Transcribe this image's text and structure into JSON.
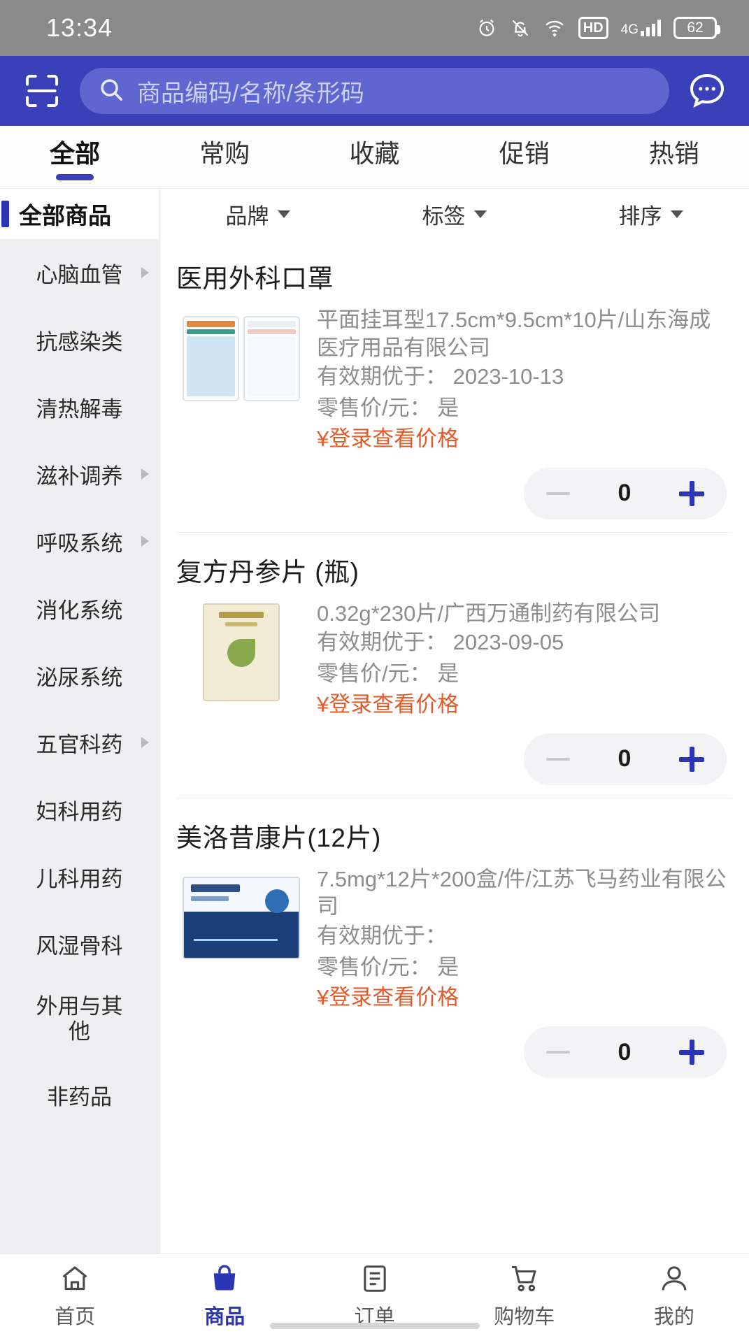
{
  "status_bar": {
    "time": "13:34",
    "icons": [
      "alarm-icon",
      "mute-icon",
      "wifi-icon",
      "hd-icon",
      "signal-4g-icon",
      "battery-icon"
    ],
    "hd_label": "HD",
    "network_label": "4G",
    "battery_level": "62"
  },
  "search": {
    "scan_icon": "scan-icon",
    "search_icon": "search-icon",
    "placeholder": "商品编码/名称/条形码",
    "value": "",
    "more_icon": "chat-more-icon"
  },
  "tabs": [
    {
      "label": "全部",
      "active": true
    },
    {
      "label": "常购",
      "active": false
    },
    {
      "label": "收藏",
      "active": false
    },
    {
      "label": "促销",
      "active": false
    },
    {
      "label": "热销",
      "active": false
    }
  ],
  "sidebar": {
    "title": "全部商品",
    "items": [
      {
        "label": "心脑血管",
        "has_arrow": true
      },
      {
        "label": "抗感染类",
        "has_arrow": false
      },
      {
        "label": "清热解毒",
        "has_arrow": false
      },
      {
        "label": "滋补调养",
        "has_arrow": true
      },
      {
        "label": "呼吸系统",
        "has_arrow": true
      },
      {
        "label": "消化系统",
        "has_arrow": false
      },
      {
        "label": "泌尿系统",
        "has_arrow": false
      },
      {
        "label": "五官科药",
        "has_arrow": true
      },
      {
        "label": "妇科用药",
        "has_arrow": false
      },
      {
        "label": "儿科用药",
        "has_arrow": false
      },
      {
        "label": "风湿骨科",
        "has_arrow": false
      },
      {
        "label": "外用与其他",
        "has_arrow": false
      },
      {
        "label": "非药品",
        "has_arrow": false
      }
    ]
  },
  "filters": [
    {
      "label": "品牌",
      "icon": "chevron-down-icon"
    },
    {
      "label": "标签",
      "icon": "chevron-down-icon"
    },
    {
      "label": "排序",
      "icon": "chevron-down-icon"
    }
  ],
  "products": [
    {
      "name": "医用外科口罩",
      "spec": "平面挂耳型17.5cm*9.5cm*10片/山东海成医疗用品有限公司",
      "expiry_label": "有效期优于：",
      "expiry_value": "2023-10-13",
      "retail_label": "零售价/元：",
      "retail_value": "是",
      "price_text": "¥登录查看价格",
      "quantity": "0",
      "minus_icon": "minus-icon",
      "plus_icon": "plus-icon",
      "thumb": "mask-package-image"
    },
    {
      "name": "复方丹参片 (瓶)",
      "spec": "0.32g*230片/广西万通制药有限公司",
      "expiry_label": "有效期优于：",
      "expiry_value": "2023-09-05",
      "retail_label": "零售价/元：",
      "retail_value": "是",
      "price_text": "¥登录查看价格",
      "quantity": "0",
      "minus_icon": "minus-icon",
      "plus_icon": "plus-icon",
      "thumb": "danshen-box-image"
    },
    {
      "name": "美洛昔康片(12片)",
      "spec": "7.5mg*12片*200盒/件/江苏飞马药业有限公司",
      "expiry_label": "有效期优于：",
      "expiry_value": "",
      "retail_label": "零售价/元：",
      "retail_value": "是",
      "price_text": "¥登录查看价格",
      "quantity": "0",
      "minus_icon": "minus-icon",
      "plus_icon": "plus-icon",
      "thumb": "meloxicam-box-image"
    }
  ],
  "bottom_nav": [
    {
      "label": "首页",
      "icon": "home-icon",
      "active": false
    },
    {
      "label": "商品",
      "icon": "bag-icon",
      "active": true
    },
    {
      "label": "订单",
      "icon": "order-list-icon",
      "active": false
    },
    {
      "label": "购物车",
      "icon": "cart-icon",
      "active": false
    },
    {
      "label": "我的",
      "icon": "user-icon",
      "active": false
    }
  ],
  "colors": {
    "brand_blue": "#3a40b8",
    "accent_blue": "#2b36b5",
    "price_orange": "#e25b2a",
    "statusbar_gray": "#8a8a8a"
  }
}
